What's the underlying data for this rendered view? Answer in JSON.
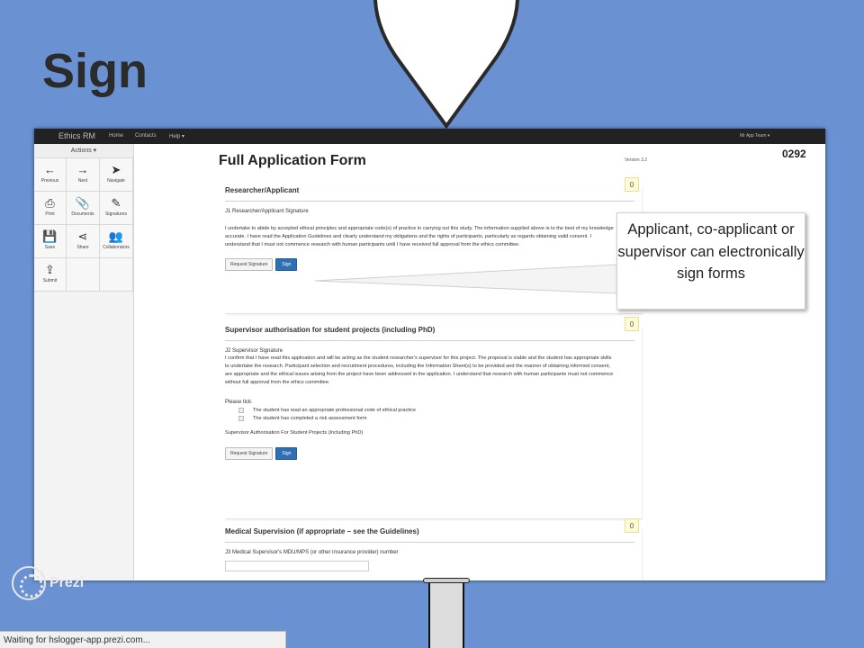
{
  "slide": {
    "title": "Sign"
  },
  "app": {
    "brand": "Ethics RM",
    "nav": [
      "Home",
      "Contacts",
      "Help ▾"
    ],
    "user": "Mr App Team ▾"
  },
  "sidebar": {
    "actions_label": "Actions ▾",
    "tools": [
      {
        "label": "Previous",
        "icon": "previous-icon",
        "glyph": "←"
      },
      {
        "label": "Next",
        "icon": "next-icon",
        "glyph": "→"
      },
      {
        "label": "Navigate",
        "icon": "navigate-icon",
        "glyph": "➤"
      },
      {
        "label": "Print",
        "icon": "print-icon",
        "glyph": "⎙"
      },
      {
        "label": "Documents",
        "icon": "paperclip-icon",
        "glyph": "📎"
      },
      {
        "label": "Signatures",
        "icon": "signature-icon",
        "glyph": "✎"
      },
      {
        "label": "Save",
        "icon": "save-icon",
        "glyph": "💾"
      },
      {
        "label": "Share",
        "icon": "share-icon",
        "glyph": "⋖"
      },
      {
        "label": "Collaborators",
        "icon": "collaborators-icon",
        "glyph": "👥"
      },
      {
        "label": "Submit",
        "icon": "submit-icon",
        "glyph": "⇪"
      }
    ]
  },
  "form": {
    "title": "Full Application Form",
    "version": "Version 3.2",
    "ref": "0292",
    "sections": [
      {
        "heading": "Researcher/Applicant",
        "score": "0",
        "question": "J1  Researcher/Applicant Signature",
        "text": "I undertake to abide by accepted ethical principles and appropriate code(s) of practice in carrying out this study. The information supplied above is to the best of my knowledge accurate. I have read the Application Guidelines and clearly understand my obligations and the rights of participants, particularly as regards obtaining valid consent. I understand that I must not commence research with human participants until I have received full approval from the ethics committee.",
        "request_label": "Request Signature",
        "sign_label": "Sign"
      },
      {
        "heading": "Supervisor authorisation for student projects (including PhD)",
        "score": "0",
        "question": "J2  Supervisor Signature",
        "text": "I confirm that I have read this application and will be acting as the student researcher's supervisor for this project. The proposal is viable and the student has appropriate skills to undertake the research. Participant selection and recruitment procedures, including the Information Sheet(s) to be provided and the manner of obtaining informed consent, are appropriate and the ethical issues arising from the project have been addressed in the application. I understand that research with human participants must not commence without full approval from the ethics committee.",
        "tick_label": "Please tick:",
        "checks": [
          "The student has read an appropriate professional code of ethical practice",
          "The student has completed a risk assessment form"
        ],
        "footnote": "Supervisor Authorisation For Student Projects (Including PhD)",
        "request_label": "Request Signature",
        "sign_label": "Sign"
      },
      {
        "heading": "Medical Supervision (if appropriate – see the Guidelines)",
        "score": "0",
        "question": "J3  Medical Supervisor's MDU/MPS (or other insurance provider) number"
      }
    ]
  },
  "callout": {
    "text": "Applicant, co-applicant or supervisor can electronically sign forms"
  },
  "prezi": {
    "label": "Prezi"
  },
  "status": {
    "text": "Waiting for hslogger-app.prezi.com..."
  },
  "colors": {
    "background": "#6a92d3",
    "accent": "#2f6fb4"
  }
}
